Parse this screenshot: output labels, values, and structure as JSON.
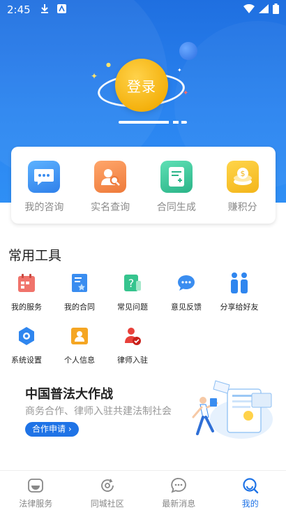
{
  "status_bar": {
    "time": "2:45"
  },
  "hero": {
    "login_label": "登录"
  },
  "quick_actions": [
    {
      "label": "我的咨询",
      "icon": "chat-bubble-icon",
      "color": "#3a8df0"
    },
    {
      "label": "实名查询",
      "icon": "person-search-icon",
      "color": "#f08a4b"
    },
    {
      "label": "合同生成",
      "icon": "document-plus-icon",
      "color": "#3dc49a"
    },
    {
      "label": "赚积分",
      "icon": "coin-stack-icon",
      "color": "#f7c12f"
    }
  ],
  "tools_section": {
    "title": "常用工具",
    "items": [
      {
        "label": "我的服务",
        "icon": "calendar-service-icon"
      },
      {
        "label": "我的合同",
        "icon": "contract-icon"
      },
      {
        "label": "常见问题",
        "icon": "question-icon"
      },
      {
        "label": "意见反馈",
        "icon": "feedback-icon"
      },
      {
        "label": "分享给好友",
        "icon": "share-icon"
      },
      {
        "label": "系统设置",
        "icon": "settings-icon"
      },
      {
        "label": "个人信息",
        "icon": "profile-card-icon"
      },
      {
        "label": "律师入驻",
        "icon": "lawyer-join-icon"
      }
    ]
  },
  "banner": {
    "title": "中国普法大作战",
    "subtitle": "商务合作、律师入驻共建法制社会",
    "button": "合作申请 ›"
  },
  "bottom_nav": [
    {
      "label": "法律服务",
      "icon": "legal-service-icon",
      "active": false
    },
    {
      "label": "同城社区",
      "icon": "community-icon",
      "active": false
    },
    {
      "label": "最新消息",
      "icon": "message-icon",
      "active": false
    },
    {
      "label": "我的",
      "icon": "my-profile-icon",
      "active": true
    }
  ],
  "colors": {
    "primary": "#1f73e6",
    "accent_gold": "#f4b10d"
  }
}
